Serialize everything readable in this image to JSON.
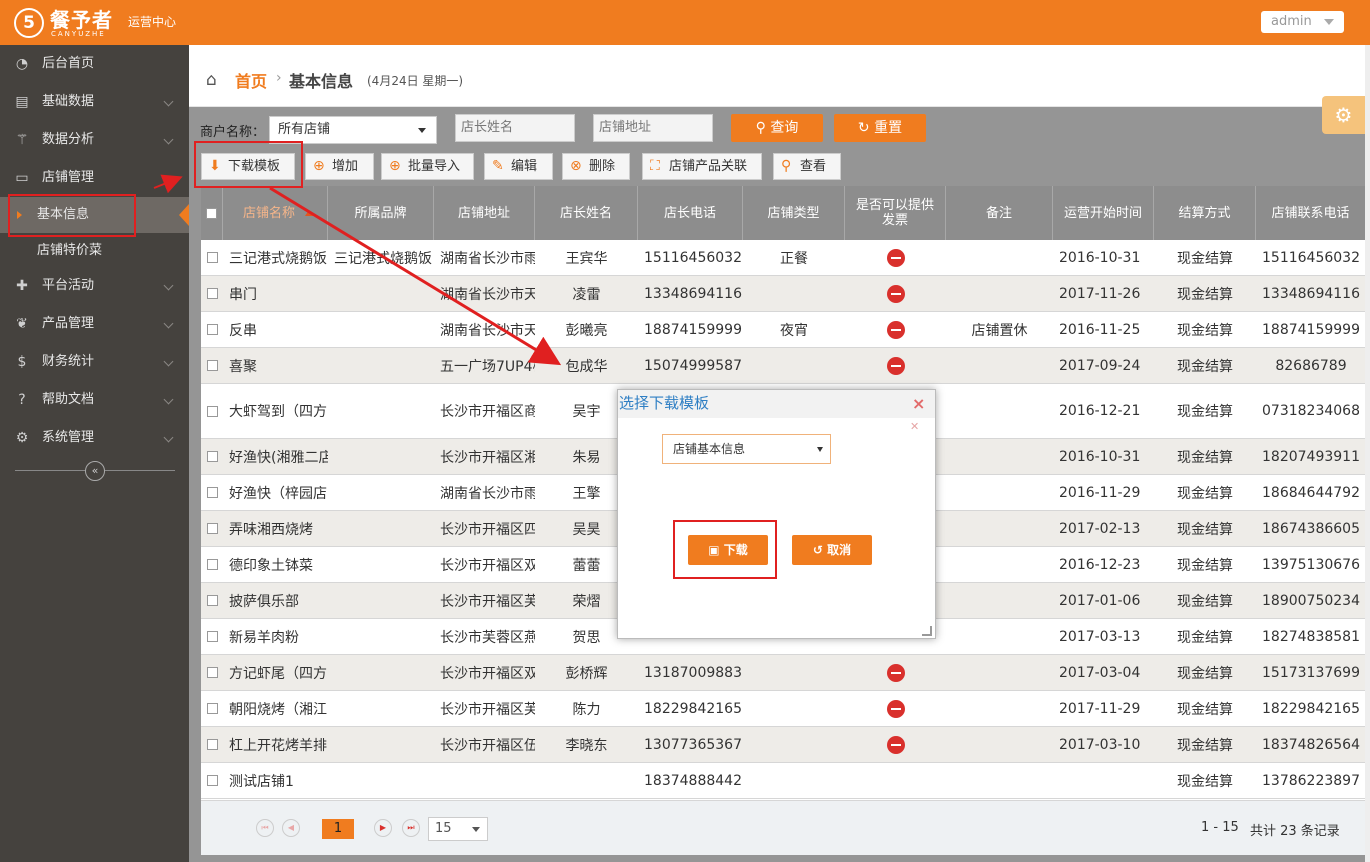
{
  "brand": {
    "logo": "5",
    "name": "餐予者",
    "latin": "CANYUZHE",
    "center": "运营中心"
  },
  "user": {
    "name": "admin"
  },
  "sidebar": {
    "items": [
      {
        "icon": "dashboard-icon",
        "glyph": "◔",
        "label": "后台首页"
      },
      {
        "icon": "book-icon",
        "glyph": "▤",
        "label": "基础数据"
      },
      {
        "icon": "magic-wand-icon",
        "glyph": "⚚",
        "label": "数据分析"
      },
      {
        "icon": "inbox-icon",
        "glyph": "▭",
        "label": "店铺管理"
      },
      {
        "icon": "gift-icon",
        "glyph": "✚",
        "label": "平台活动"
      },
      {
        "icon": "leaf-icon",
        "glyph": "❦",
        "label": "产品管理"
      },
      {
        "icon": "dollar-icon",
        "glyph": "$",
        "label": "财务统计"
      },
      {
        "icon": "question-icon",
        "glyph": "?",
        "label": "帮助文档"
      },
      {
        "icon": "cogs-icon",
        "glyph": "⚙",
        "label": "系统管理"
      }
    ],
    "subitems": [
      {
        "label": "基本信息",
        "active": true
      },
      {
        "label": "店铺特价菜",
        "active": false
      }
    ],
    "collapse": "«"
  },
  "breadcrumb": {
    "home": "首页",
    "sep": "›",
    "current": "基本信息",
    "date": "(4月24日 星期一)"
  },
  "filter": {
    "merchant_label": "商户名称：",
    "merchant_value": "所有店铺",
    "manager_placeholder": "店长姓名",
    "address_placeholder": "店铺地址",
    "search": "查询",
    "reset": "重置"
  },
  "toolbar": {
    "download_template": "下载模板",
    "add": "增加",
    "batch_import": "批量导入",
    "edit": "编辑",
    "delete": "删除",
    "product_link": "店铺产品关联",
    "view": "查看"
  },
  "table": {
    "columns": [
      "店铺名称",
      "所属品牌",
      "店铺地址",
      "店长姓名",
      "店长电话",
      "店铺类型",
      "是否可以提供发票",
      "备注",
      "运营开始时间",
      "结算方式",
      "店铺联系电话"
    ],
    "rows": [
      [
        "三记港式烧鹅饭",
        "三记港式烧鹅饭",
        "湖南省长沙市雨",
        "王宾华",
        "15116456032",
        "正餐",
        "no",
        "",
        "2016-10-31",
        "现金结算",
        "15116456032"
      ],
      [
        "串门",
        "",
        "湖南省长沙市天",
        "凌雷",
        "13348694116",
        "",
        "no",
        "",
        "2017-11-26",
        "现金结算",
        "13348694116"
      ],
      [
        "反串",
        "",
        "湖南省长沙市天",
        "彭曦亮",
        "18874159999",
        "夜宵",
        "no",
        "店铺置休",
        "2016-11-25",
        "现金结算",
        "18874159999"
      ],
      [
        "喜聚",
        "",
        "五一广场7UP4楼",
        "包成华",
        "15074999587",
        "",
        "no",
        "",
        "2017-09-24",
        "现金结算",
        "82686789"
      ],
      [
        "大虾驾到（四方",
        "",
        "长沙市开福区商",
        "吴宇",
        "",
        "",
        "",
        "",
        "2016-12-21",
        "现金结算",
        "07318234068"
      ],
      [
        "好渔快(湘雅二店",
        "",
        "长沙市开福区湘",
        "朱易",
        "",
        "",
        "",
        "",
        "2016-10-31",
        "现金结算",
        "18207493911"
      ],
      [
        "好渔快（梓园店",
        "",
        "湖南省长沙市雨",
        "王擎",
        "",
        "",
        "",
        "",
        "2016-11-29",
        "现金结算",
        "18684644792"
      ],
      [
        "弄味湘西烧烤",
        "",
        "长沙市开福区四",
        "吴昊",
        "",
        "",
        "",
        "",
        "2017-02-13",
        "现金结算",
        "18674386605"
      ],
      [
        "德印象土钵菜",
        "",
        "长沙市开福区双",
        "蕾蕾",
        "",
        "",
        "",
        "",
        "2016-12-23",
        "现金结算",
        "13975130676"
      ],
      [
        "披萨俱乐部",
        "",
        "长沙市开福区芙",
        "荣熠",
        "",
        "",
        "",
        "",
        "2017-01-06",
        "现金结算",
        "18900750234"
      ],
      [
        "新易羊肉粉",
        "",
        "长沙市芙蓉区燕",
        "贺思",
        "",
        "",
        "",
        "",
        "2017-03-13",
        "现金结算",
        "18274838581"
      ],
      [
        "方记虾尾（四方",
        "",
        "长沙市开福区双",
        "彭桥辉",
        "13187009883",
        "",
        "no",
        "",
        "2017-03-04",
        "现金结算",
        "15173137699"
      ],
      [
        "朝阳烧烤（湘江",
        "",
        "长沙市开福区芙",
        "陈力",
        "18229842165",
        "",
        "no",
        "",
        "2017-11-29",
        "现金结算",
        "18229842165"
      ],
      [
        "杠上开花烤羊排",
        "",
        "长沙市开福区伍",
        "李晓东",
        "13077365367",
        "",
        "no",
        "",
        "2017-03-10",
        "现金结算",
        "18374826564"
      ],
      [
        "测试店铺1",
        "",
        "",
        "",
        "18374888442",
        "",
        "",
        "",
        "",
        "现金结算",
        "13786223897"
      ]
    ]
  },
  "pager": {
    "page": "1",
    "size": "15",
    "range": "1 - 15",
    "total": "共计 23 条记录"
  },
  "dialog": {
    "title": "选择下载模板",
    "select_value": "店铺基本信息",
    "download": "下载",
    "cancel": "取消"
  },
  "colors": {
    "accent": "#f07c1f",
    "sidebar": "#45423e",
    "highlight": "#e02020",
    "danger": "#d9302c"
  }
}
